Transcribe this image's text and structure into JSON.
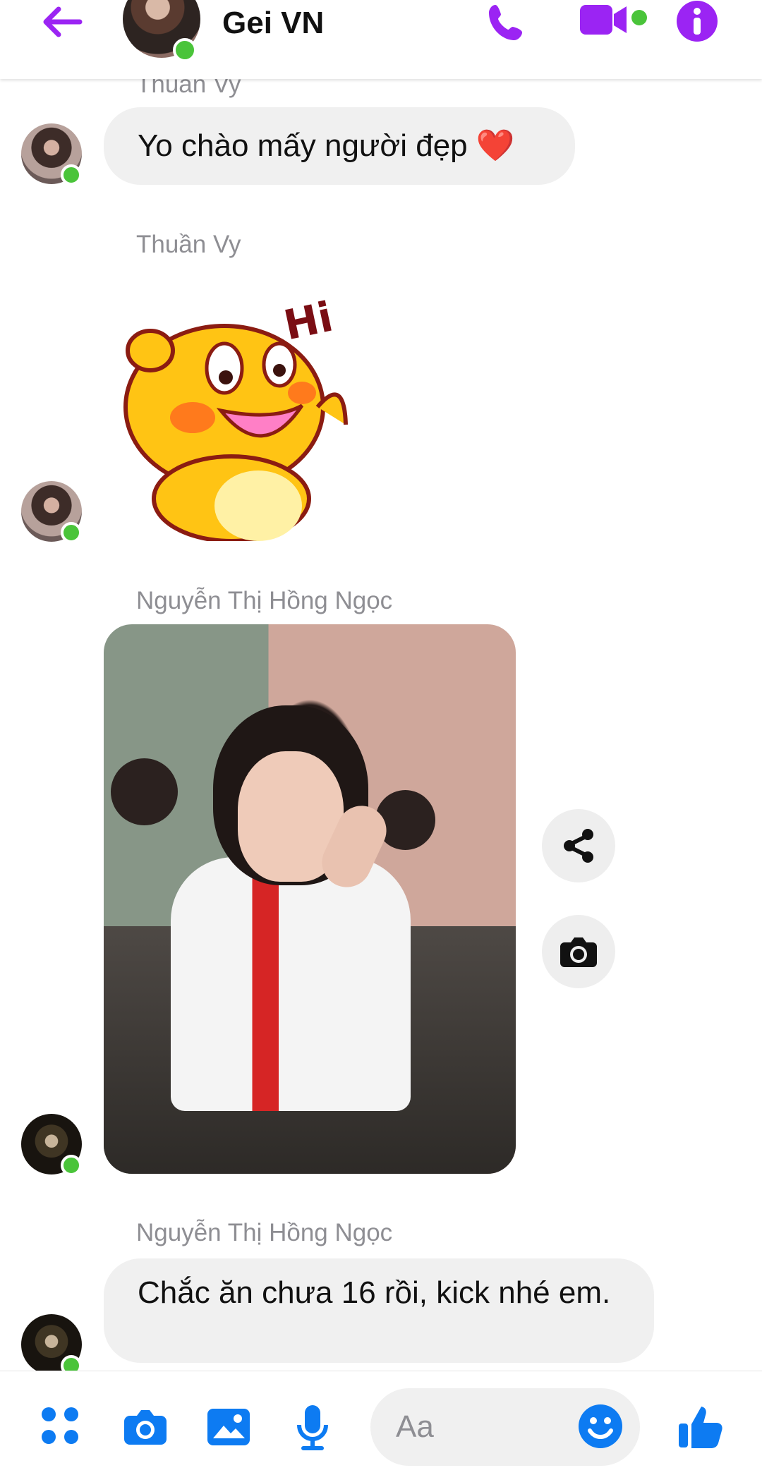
{
  "header": {
    "title": "Gei VN",
    "icons": {
      "back": "arrow-left-icon",
      "call": "phone-icon",
      "video": "video-camera-icon",
      "info": "info-icon"
    },
    "accent": "#9b24f3",
    "online": "#4ac43a"
  },
  "messages": [
    {
      "sender": "Thuần Vy",
      "text": "Yo chào mấy người đẹp ❤️"
    },
    {
      "sender": "Thuần Vy",
      "type": "sticker",
      "sticker_text": "Hi"
    },
    {
      "sender": "Nguyễn Thị Hồng Ngọc",
      "type": "photo"
    },
    {
      "sender": "Nguyễn Thị Hồng Ngọc",
      "text": "Chắc ăn chưa 16 rồi, kick nhé em."
    }
  ],
  "photo_actions": {
    "share": "share-icon",
    "camera": "camera-icon"
  },
  "composer": {
    "placeholder": "Aa",
    "icons": [
      "menu-dots-icon",
      "camera-icon",
      "image-icon",
      "microphone-icon",
      "emoji-icon",
      "thumbs-up-icon"
    ],
    "blue": "#0d7bf2"
  }
}
